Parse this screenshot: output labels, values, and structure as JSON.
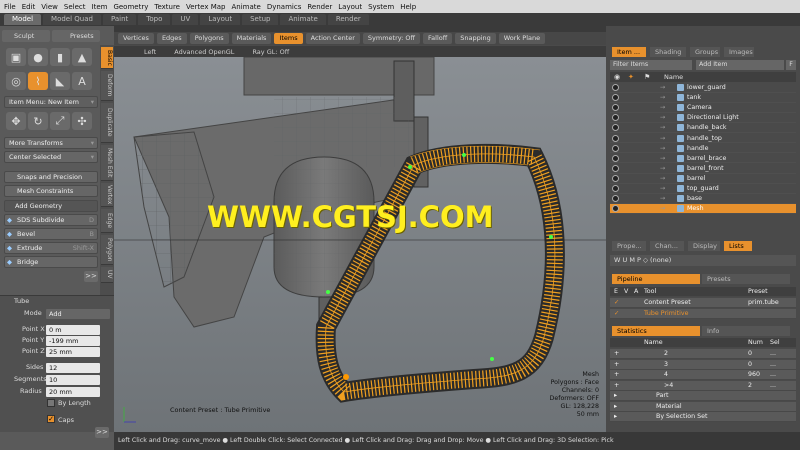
{
  "menu": [
    "File",
    "Edit",
    "View",
    "Select",
    "Item",
    "Geometry",
    "Texture",
    "Vertex Map",
    "Animate",
    "Dynamics",
    "Render",
    "Layout",
    "System",
    "Help"
  ],
  "layout_tabs": [
    "Model",
    "Model Quad",
    "Paint",
    "Topo",
    "UV",
    "Layout",
    "Setup",
    "Animate",
    "Render"
  ],
  "layout_tabs_active": 0,
  "left": {
    "sculpt": "Sculpt",
    "presets": "Presets",
    "side_tabs": [
      "Basic",
      "Deform",
      "Duplicate",
      "Mesh Edit",
      "Vertex",
      "Edge",
      "Polygon",
      "UV"
    ],
    "item_menu": "Item Menu: New Item",
    "more_transforms": "More Transforms",
    "center_selected": "Center Selected",
    "snaps": "Snaps and Precision",
    "mesh_constraints": "Mesh Constraints",
    "add_geometry": "Add Geometry",
    "tools": [
      {
        "label": "SDS Subdivide",
        "key": "D"
      },
      {
        "label": "Bevel",
        "key": "B"
      },
      {
        "label": "Extrude",
        "key": "Shift-X"
      },
      {
        "label": "Bridge",
        "key": ""
      }
    ],
    "more": ">>",
    "tube": {
      "title": "Tube",
      "mode_label": "Mode",
      "mode_value": "Add",
      "fields": [
        {
          "label": "Point X",
          "value": "0 m"
        },
        {
          "label": "Point Y",
          "value": "-199 mm"
        },
        {
          "label": "Point Z",
          "value": "25 mm"
        }
      ],
      "sides_label": "Sides",
      "sides_value": "12",
      "segments_label": "Segments",
      "segments_value": "10",
      "radius_label": "Radius",
      "radius_value": "20 mm",
      "by_length": "By Length",
      "caps": "Caps"
    }
  },
  "toolbar": [
    "Vertices",
    "Edges",
    "Polygons",
    "Materials",
    "Items",
    "Action Center",
    "Symmetry: Off",
    "Falloff",
    "Snapping",
    "Work Plane"
  ],
  "toolbar_active": "Items",
  "viewport_header": [
    "Left",
    "Advanced OpenGL",
    "Ray GL: Off"
  ],
  "viewport_info": {
    "lines": [
      "Mesh",
      "Polygons : Face",
      "Channels: 0",
      "Deformers: OFF",
      "GL: 128,228",
      "50 mm"
    ],
    "content_preset": "Content Preset : Tube Primitive"
  },
  "watermark": "WWW.CGTSJ.COM",
  "status": "Left Click and Drag: curve_move ● Left Double Click: Select Connected ● Left Click and Drag: Drag and Drop: Move ● Left Click and Drag: 3D Selection: Pick",
  "right": {
    "top_tabs": [
      "Item ...",
      "Shading",
      "Groups",
      "Images"
    ],
    "filter": "Filter Items",
    "add_item": "Add Item",
    "add_item_key": "F",
    "name_header": "Name",
    "items": [
      "lower_guard",
      "tank",
      "Camera",
      "Directional Light",
      "handle_back",
      "handle_top",
      "handle",
      "barrel_brace",
      "barrel_front",
      "barrel",
      "top_guard",
      "base",
      "Mesh"
    ],
    "selected_item": "Mesh",
    "mid_tabs": [
      "Prope...",
      "Chan...",
      "Display",
      "Lists"
    ],
    "mid_active": "Lists",
    "wump": "W U M P ◇ (none)",
    "pipeline_tabs": [
      "Pipeline",
      "Presets"
    ],
    "pipe_header": [
      "E",
      "V",
      "A",
      "Tool",
      "Preset"
    ],
    "pipe_rows": [
      {
        "tool": "Content Preset",
        "preset": "prim.tube"
      },
      {
        "tool": "Tube Primitive",
        "preset": ""
      }
    ],
    "stats_tabs": [
      "Statistics",
      "Info"
    ],
    "stats_header": [
      "Name",
      "Num",
      "Sel"
    ],
    "stats_rows": [
      {
        "name": "2",
        "num": "0",
        "sel": "..."
      },
      {
        "name": "3",
        "num": "0",
        "sel": "..."
      },
      {
        "name": "4",
        "num": "960",
        "sel": "..."
      },
      {
        "name": ">4",
        "num": "2",
        "sel": "..."
      },
      {
        "name": "Part",
        "num": "",
        "sel": ""
      },
      {
        "name": "Material",
        "num": "",
        "sel": ""
      },
      {
        "name": "By Selection Set",
        "num": "",
        "sel": ""
      }
    ]
  },
  "colors": {
    "accent": "#e8912d",
    "watermark": "#ffef1f",
    "wire": "#f0a020"
  }
}
